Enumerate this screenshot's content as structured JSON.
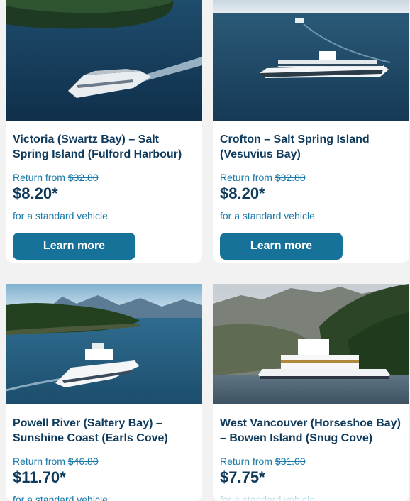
{
  "cards": [
    {
      "title": "Victoria (Swartz Bay) – Salt Spring Island (Fulford Harbour)",
      "return_prefix": "Return from ",
      "old_price": "$32.80",
      "price": "$8.20*",
      "note": "for a standard vehicle",
      "button_label": "Learn more"
    },
    {
      "title": "Crofton – Salt Spring Island (Vesuvius Bay)",
      "return_prefix": "Return from ",
      "old_price": "$32.80",
      "price": "$8.20*",
      "note": "for a standard vehicle",
      "button_label": "Learn more"
    },
    {
      "title": "Powell River (Saltery Bay) –\n Sunshine Coast (Earls Cove)",
      "return_prefix": "Return from ",
      "old_price": "$46.80",
      "price": "$11.70*",
      "note": "for a standard vehicle"
    },
    {
      "title": "West Vancouver (Horseshoe Bay) – Bowen Island (Snug Cove)",
      "return_prefix": "Return from ",
      "old_price": "$31.00",
      "price": "$7.75*",
      "note": "for a standard vehicle"
    }
  ],
  "colors": {
    "title": "#0e3a5c",
    "link_text": "#1a7aa8",
    "button": "#17729a",
    "background": "#f2f2f2"
  }
}
